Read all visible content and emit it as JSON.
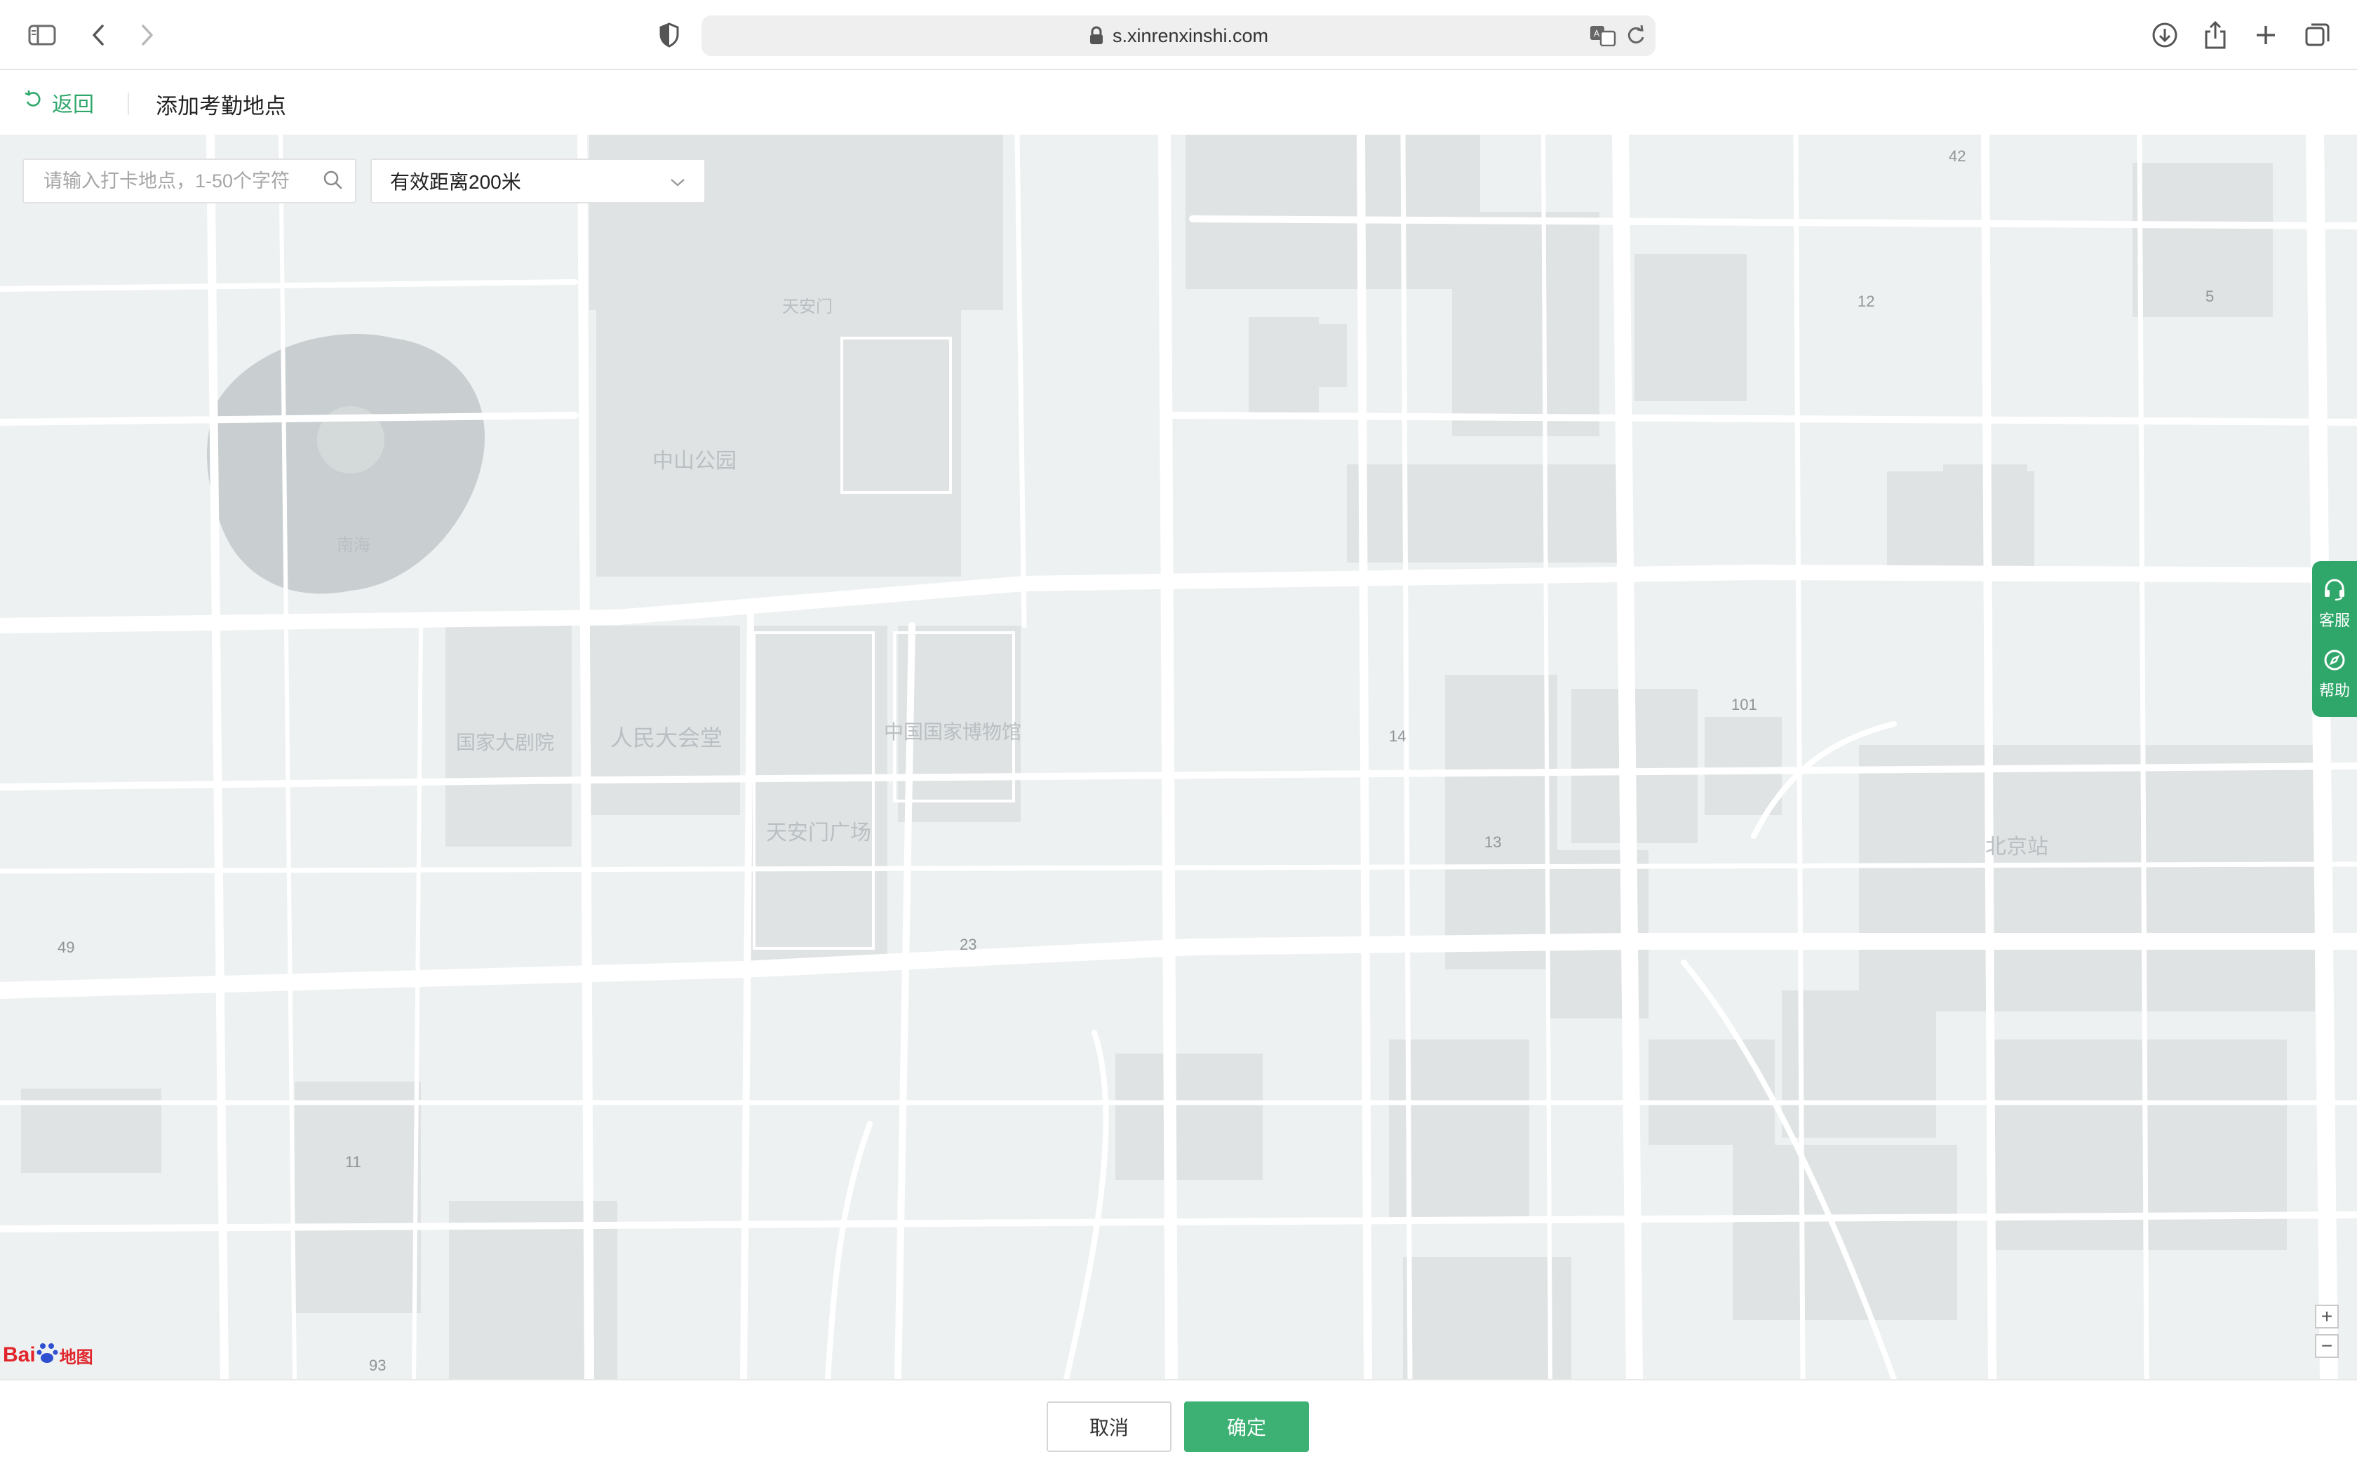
{
  "browser": {
    "url": "s.xinrenxinshi.com",
    "icons": [
      "sidebar-icon",
      "back-arrow-icon",
      "forward-arrow-icon",
      "privacy-shield-icon",
      "lock-icon",
      "translate-icon",
      "reload-icon",
      "download-icon",
      "share-icon",
      "new-tab-icon",
      "tab-overview-icon"
    ]
  },
  "header": {
    "back_label": "返回",
    "title": "添加考勤地点"
  },
  "map": {
    "search_placeholder": "请输入打卡地点，1-50个字符",
    "range_selected": "有效距离200米",
    "side_tools": {
      "service_label": "客服",
      "help_label": "帮助"
    },
    "zoom_in": "+",
    "zoom_out": "−",
    "logo_text": "Bai",
    "logo_suffix": "地图",
    "labels": {
      "nanhai": "南海",
      "zhongshan_park": "中山公园",
      "theater": "国家大剧院",
      "great_hall": "人民大会堂",
      "tiananmen_square": "天安门广场",
      "museum": "中国国家博物馆",
      "tiananmen": "天安门",
      "beijing_station": "北京站",
      "num_12": "12",
      "num_101": "101",
      "num_14": "14",
      "num_13": "13",
      "num_23": "23",
      "num_49": "49",
      "num_11": "11",
      "num_93": "93",
      "num_42": "42",
      "num_5": "5"
    }
  },
  "footer": {
    "cancel_label": "取消",
    "confirm_label": "确定"
  },
  "colors": {
    "accent": "#3db174",
    "map_background": "#eef1f2",
    "map_block": "#dfe3e4",
    "map_road": "#ffffff"
  }
}
